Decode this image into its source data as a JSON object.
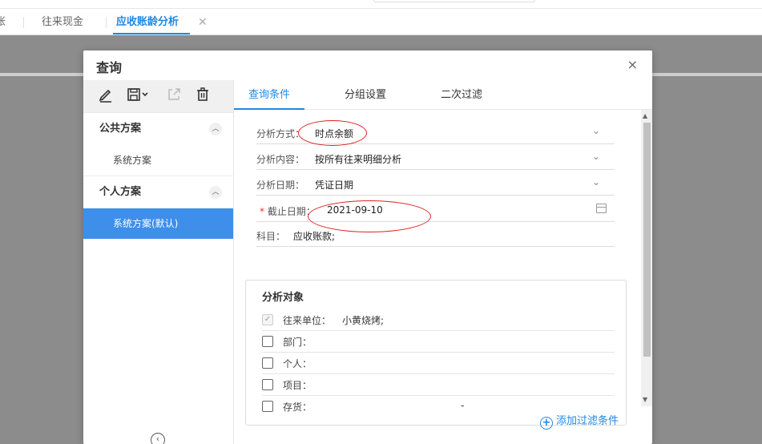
{
  "tabs": {
    "partial": "账",
    "cash": "往来现金",
    "active": "应收账龄分析",
    "close": "✕"
  },
  "dialog": {
    "title": "查询",
    "close": "×"
  },
  "sidebar": {
    "public_group": "公共方案",
    "public_items": [
      "系统方案"
    ],
    "personal_group": "个人方案",
    "personal_items": [
      "系统方案(默认)"
    ],
    "chevron": "︿",
    "collapse": "‹"
  },
  "right_tabs": [
    "查询条件",
    "分组设置",
    "二次过滤"
  ],
  "form": {
    "mode": {
      "label": "分析方式：",
      "value": "时点余额"
    },
    "content": {
      "label": "分析内容：",
      "value": "按所有往来明细分析"
    },
    "date": {
      "label": "分析日期：",
      "value": "凭证日期"
    },
    "cutoff": {
      "required": "*",
      "label": "截止日期：",
      "value": "2021-09-10"
    },
    "subject": {
      "label": "科目：",
      "value": "应收账款;"
    },
    "dropdown": "⌄"
  },
  "panel": {
    "title": "分析对象",
    "rows": [
      {
        "label": "往来单位：",
        "value": "小黄烧烤;",
        "checked": true
      },
      {
        "label": "部门：",
        "value": "",
        "checked": false
      },
      {
        "label": "个人：",
        "value": "",
        "checked": false
      },
      {
        "label": "项目：",
        "value": "",
        "checked": false
      },
      {
        "label": "存货：",
        "value": "-",
        "checked": false
      }
    ]
  },
  "checkmark": "✓",
  "add_filter": "添加过滤条件",
  "add_symbol": "+",
  "scroll": {
    "up": "▲",
    "down": "▼"
  },
  "icons": [
    "edit-icon",
    "save-icon",
    "export-icon",
    "delete-icon",
    "calendar-icon",
    "chevron-down-icon",
    "plus-circle-icon",
    "collapse-icon"
  ]
}
